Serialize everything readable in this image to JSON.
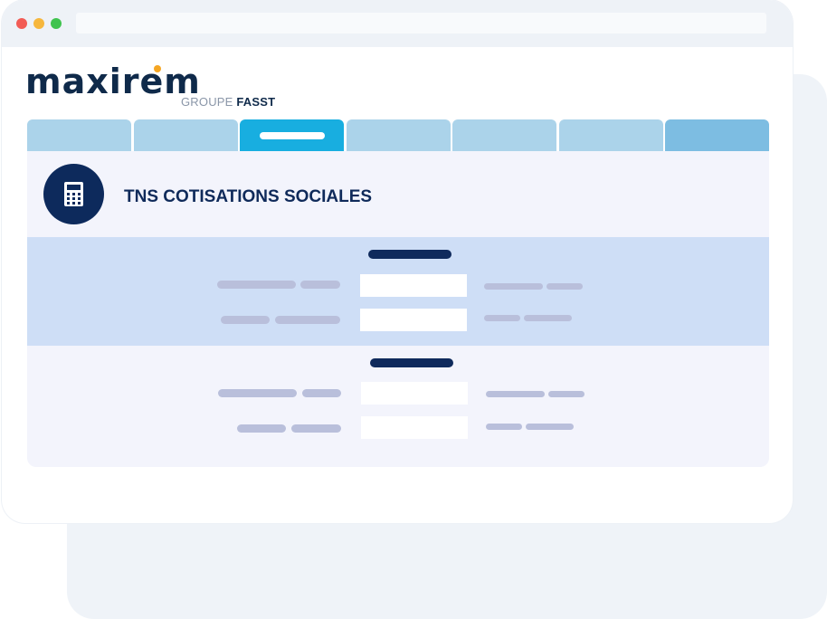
{
  "logo": {
    "name": "maxirem",
    "tagline_prefix": "GROUPE",
    "tagline_brand": "FASST",
    "accent_color": "#f5a623"
  },
  "tabs": [
    {
      "state": "inactive"
    },
    {
      "state": "inactive"
    },
    {
      "state": "active"
    },
    {
      "state": "inactive"
    },
    {
      "state": "inactive"
    },
    {
      "state": "inactive"
    },
    {
      "state": "inactive"
    }
  ],
  "page": {
    "title": "TNS COTISATIONS SOCIALES",
    "icon": "calculator-icon"
  },
  "colors": {
    "primary": "#0d2a5c",
    "tab": "#abd3ea",
    "tab_active": "#18aee0",
    "band": "#cedef6"
  }
}
